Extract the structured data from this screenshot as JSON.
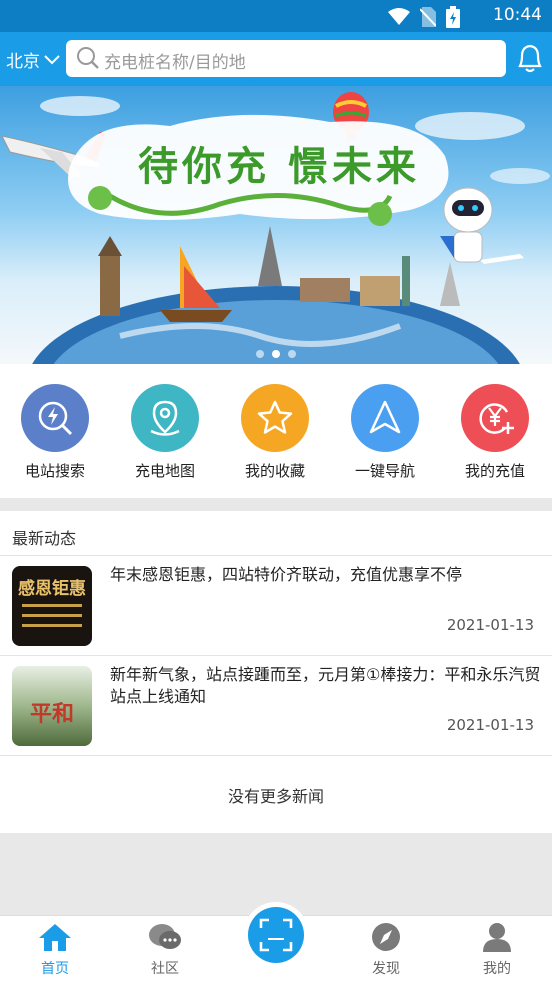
{
  "status_bar": {
    "time": "10:44"
  },
  "header": {
    "city": "北京",
    "search_placeholder": "充电桩名称/目的地"
  },
  "banner": {
    "slogan": "待你充 憬未来",
    "slide_count": 3,
    "active_slide": 2
  },
  "quick_actions": [
    {
      "label": "电站搜索",
      "icon": "station-search-icon",
      "color": "#5b7fc9"
    },
    {
      "label": "充电地图",
      "icon": "map-pin-icon",
      "color": "#3fb6c4"
    },
    {
      "label": "我的收藏",
      "icon": "star-icon",
      "color": "#f5a623"
    },
    {
      "label": "一键导航",
      "icon": "navigation-arrow-icon",
      "color": "#4a9ff0"
    },
    {
      "label": "我的充值",
      "icon": "yen-plus-icon",
      "color": "#ee4e55"
    }
  ],
  "news": {
    "section_title": "最新动态",
    "items": [
      {
        "title": "年末感恩钜惠，四站特价齐联动，充值优惠享不停",
        "date": "2021-01-13",
        "thumb_text": "感恩钜惠"
      },
      {
        "title": "新年新气象，站点接踵而至，元月第①棒接力：平和永乐汽贸站点上线通知",
        "date": "2021-01-13",
        "thumb_text": "平和"
      }
    ],
    "no_more": "没有更多新闻"
  },
  "tabs": [
    {
      "label": "首页",
      "icon": "home-icon",
      "active": true
    },
    {
      "label": "社区",
      "icon": "chat-bubbles-icon",
      "active": false
    },
    {
      "label": "发现",
      "icon": "compass-icon",
      "active": false
    },
    {
      "label": "我的",
      "icon": "user-icon",
      "active": false
    }
  ],
  "colors": {
    "primary": "#1a9de6",
    "status_bar": "#0d7ec4"
  }
}
